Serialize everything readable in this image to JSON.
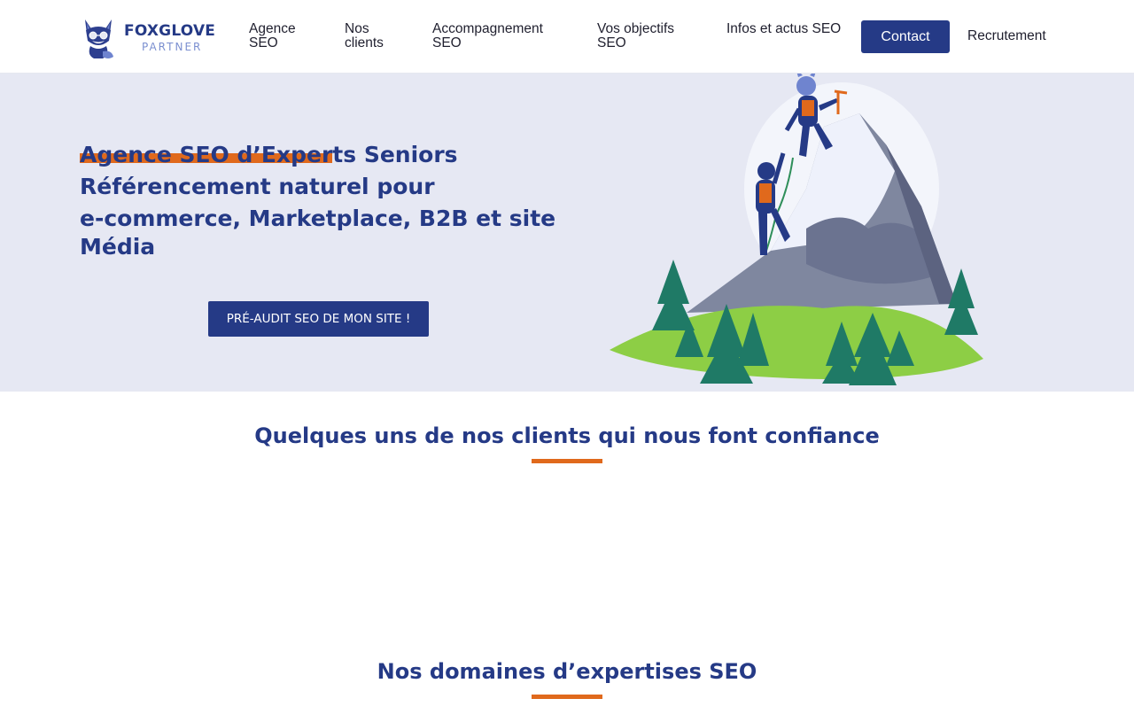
{
  "brand": {
    "name": "FOXGLOVE",
    "subtitle": "PARTNER",
    "logo_icon": "fox-icon",
    "primary_color": "#253a86",
    "accent_color": "#e0691c"
  },
  "nav": {
    "items": [
      {
        "label": "Agence SEO"
      },
      {
        "label": "Nos clients"
      },
      {
        "label": "Accompagnement SEO"
      },
      {
        "label": "Vos objectifs SEO"
      },
      {
        "label": "Infos et actus SEO"
      }
    ],
    "contact_label": "Contact",
    "recruitment_label": "Recrutement"
  },
  "hero": {
    "title_lines": [
      "Agence SEO d’Experts Seniors",
      "Référencement naturel pour",
      "e-commerce, Marketplace, B2B et site",
      "Média"
    ],
    "cta_label": "PRÉ-AUDIT SEO DE MON SITE !",
    "illustration": "mountain-climbers-illustration"
  },
  "sections": {
    "clients_title": "Quelques uns de nos clients qui nous font confiance",
    "expertise_title": "Nos domaines d’expertises SEO"
  }
}
